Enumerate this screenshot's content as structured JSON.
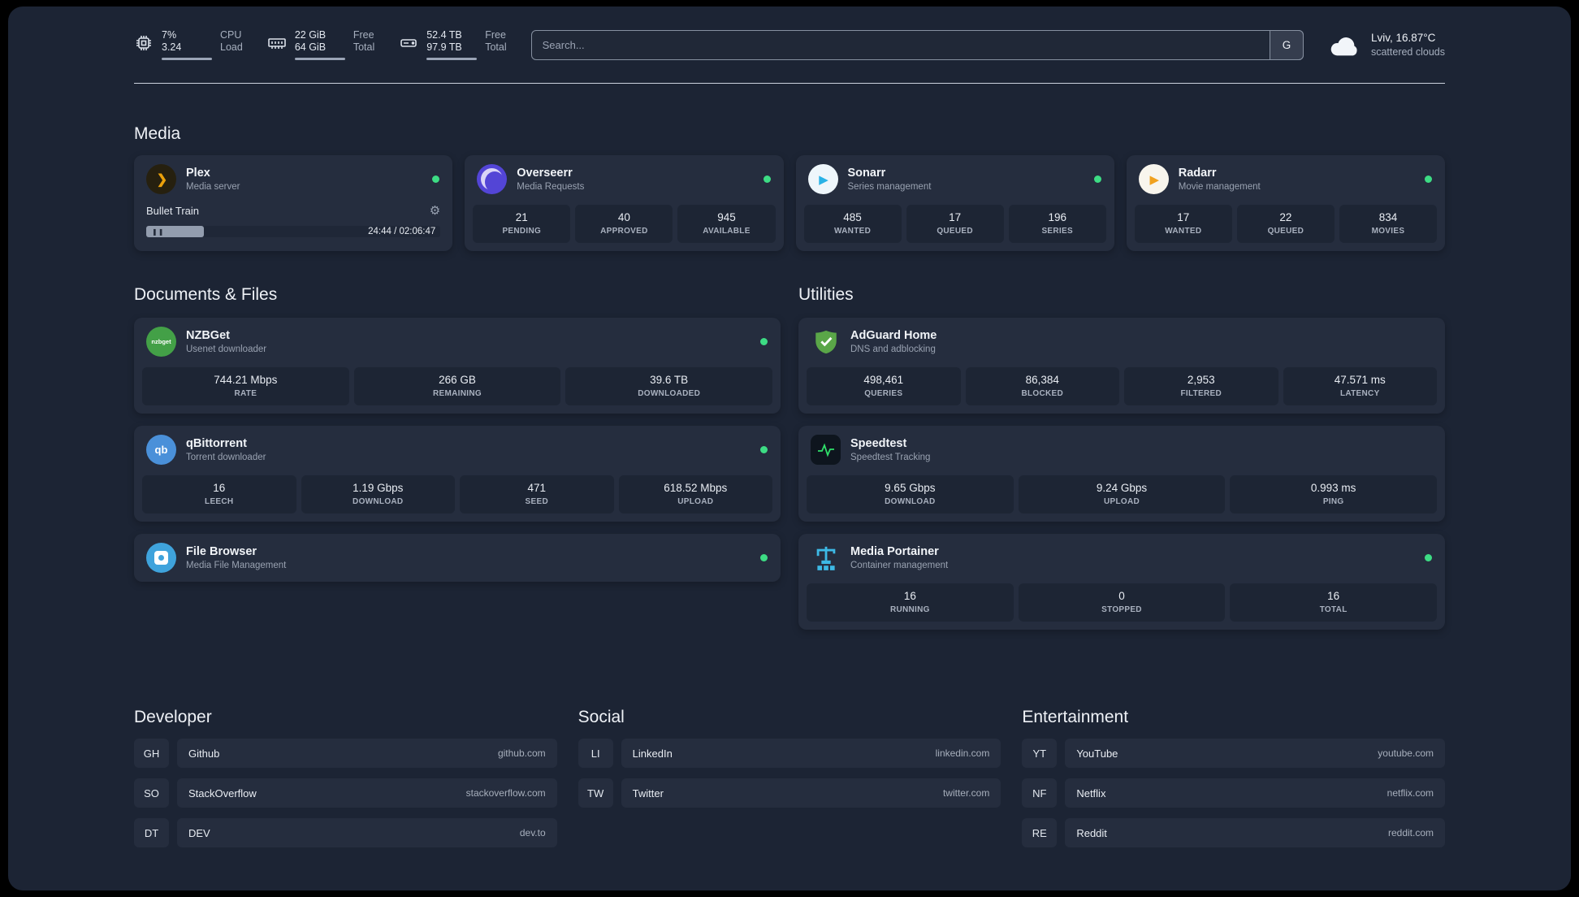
{
  "colors": {
    "background": "#1c2434",
    "card": "#252d3e",
    "tile": "#1d2534",
    "status_online": "#3ddc84"
  },
  "headings": {
    "media": "Media",
    "documents": "Documents & Files",
    "utilities": "Utilities",
    "developer": "Developer",
    "social": "Social",
    "entertainment": "Entertainment"
  },
  "icons": {
    "plex": "❯",
    "sonarr": "▶",
    "radarr": "▶",
    "gear": "⚙",
    "pause": "❚❚",
    "qbittorrent": "qb",
    "nzbget": "nzbget"
  },
  "topbar": {
    "cpu": {
      "value_top": "7%",
      "value_bottom": "3.24",
      "label_top": "CPU",
      "label_bottom": "Load"
    },
    "memory": {
      "value_top": "22 GiB",
      "value_bottom": "64 GiB",
      "label_top": "Free",
      "label_bottom": "Total"
    },
    "disk": {
      "value_top": "52.4 TB",
      "value_bottom": "97.9 TB",
      "label_top": "Free",
      "label_bottom": "Total"
    },
    "search": {
      "placeholder": "Search...",
      "provider": "G"
    },
    "weather": {
      "location": "Lviv, 16.87°C",
      "condition": "scattered clouds"
    }
  },
  "media": {
    "plex": {
      "name": "Plex",
      "subtitle": "Media server",
      "now_playing": "Bullet Train",
      "time": "24:44 / 02:06:47"
    },
    "overseerr": {
      "name": "Overseerr",
      "subtitle": "Media Requests",
      "stats": [
        {
          "value": "21",
          "label": "PENDING"
        },
        {
          "value": "40",
          "label": "APPROVED"
        },
        {
          "value": "945",
          "label": "AVAILABLE"
        }
      ]
    },
    "sonarr": {
      "name": "Sonarr",
      "subtitle": "Series management",
      "stats": [
        {
          "value": "485",
          "label": "WANTED"
        },
        {
          "value": "17",
          "label": "QUEUED"
        },
        {
          "value": "196",
          "label": "SERIES"
        }
      ]
    },
    "radarr": {
      "name": "Radarr",
      "subtitle": "Movie management",
      "stats": [
        {
          "value": "17",
          "label": "WANTED"
        },
        {
          "value": "22",
          "label": "QUEUED"
        },
        {
          "value": "834",
          "label": "MOVIES"
        }
      ]
    }
  },
  "documents": {
    "nzbget": {
      "name": "NZBGet",
      "subtitle": "Usenet downloader",
      "stats": [
        {
          "value": "744.21 Mbps",
          "label": "RATE"
        },
        {
          "value": "266 GB",
          "label": "REMAINING"
        },
        {
          "value": "39.6 TB",
          "label": "DOWNLOADED"
        }
      ]
    },
    "qbittorrent": {
      "name": "qBittorrent",
      "subtitle": "Torrent downloader",
      "stats": [
        {
          "value": "16",
          "label": "LEECH"
        },
        {
          "value": "1.19 Gbps",
          "label": "DOWNLOAD"
        },
        {
          "value": "471",
          "label": "SEED"
        },
        {
          "value": "618.52 Mbps",
          "label": "UPLOAD"
        }
      ]
    },
    "filebrowser": {
      "name": "File Browser",
      "subtitle": "Media File Management"
    }
  },
  "utilities": {
    "adguard": {
      "name": "AdGuard Home",
      "subtitle": "DNS and adblocking",
      "stats": [
        {
          "value": "498,461",
          "label": "QUERIES"
        },
        {
          "value": "86,384",
          "label": "BLOCKED"
        },
        {
          "value": "2,953",
          "label": "FILTERED"
        },
        {
          "value": "47.571 ms",
          "label": "LATENCY"
        }
      ]
    },
    "speedtest": {
      "name": "Speedtest",
      "subtitle": "Speedtest Tracking",
      "stats": [
        {
          "value": "9.65 Gbps",
          "label": "DOWNLOAD"
        },
        {
          "value": "9.24 Gbps",
          "label": "UPLOAD"
        },
        {
          "value": "0.993 ms",
          "label": "PING"
        }
      ]
    },
    "portainer": {
      "name": "Media Portainer",
      "subtitle": "Container management",
      "stats": [
        {
          "value": "16",
          "label": "RUNNING"
        },
        {
          "value": "0",
          "label": "STOPPED"
        },
        {
          "value": "16",
          "label": "TOTAL"
        }
      ]
    }
  },
  "bookmarks": {
    "developer": [
      {
        "abbr": "GH",
        "name": "Github",
        "url": "github.com"
      },
      {
        "abbr": "SO",
        "name": "StackOverflow",
        "url": "stackoverflow.com"
      },
      {
        "abbr": "DT",
        "name": "DEV",
        "url": "dev.to"
      }
    ],
    "social": [
      {
        "abbr": "LI",
        "name": "LinkedIn",
        "url": "linkedin.com"
      },
      {
        "abbr": "TW",
        "name": "Twitter",
        "url": "twitter.com"
      }
    ],
    "entertainment": [
      {
        "abbr": "YT",
        "name": "YouTube",
        "url": "youtube.com"
      },
      {
        "abbr": "NF",
        "name": "Netflix",
        "url": "netflix.com"
      },
      {
        "abbr": "RE",
        "name": "Reddit",
        "url": "reddit.com"
      }
    ]
  }
}
